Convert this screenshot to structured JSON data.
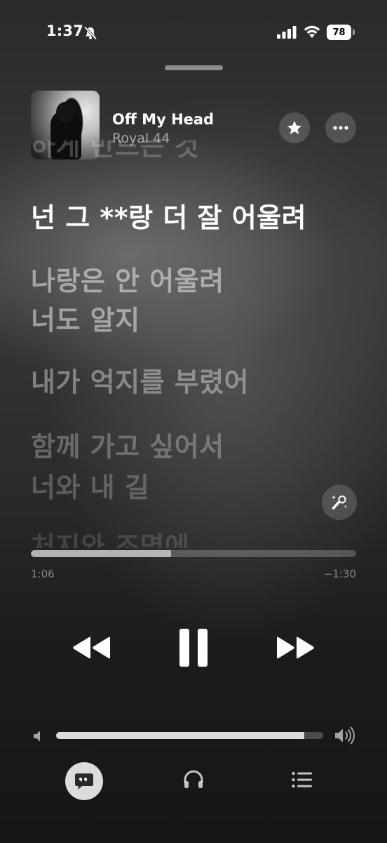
{
  "status_bar": {
    "time": "1:37",
    "battery_level": "78",
    "icons": [
      "bell-slash-icon",
      "cellular-signal-icon",
      "wifi-icon",
      "battery-icon"
    ]
  },
  "now_playing": {
    "title": "Off My Head",
    "artist": "Royal 44",
    "artwork": "album-artwork"
  },
  "lyrics": {
    "previous": "하게 만드는 것",
    "current": "넌 그 **랑 더 잘 어울려",
    "upcoming": [
      "나랑은 안 어울려",
      "너도 알지",
      "내가 억지를 부렸어",
      "함께 가고 싶어서",
      "너와 내 길",
      "처지와 조명에"
    ]
  },
  "progress": {
    "elapsed": "1:06",
    "remaining": "−1:30",
    "fraction": 0.43
  },
  "volume": {
    "level": 0.93
  },
  "colors": {
    "background_dark": "#1b1b1b",
    "background_light": "#3a3a3a",
    "accent": "#ffffff"
  },
  "controls": {
    "icons": [
      "rewind-icon",
      "pause-icon",
      "fast-forward-icon"
    ]
  },
  "tabs": {
    "icons": [
      "lyrics-quote-icon",
      "airplay-audio-icon",
      "queue-list-icon"
    ]
  }
}
